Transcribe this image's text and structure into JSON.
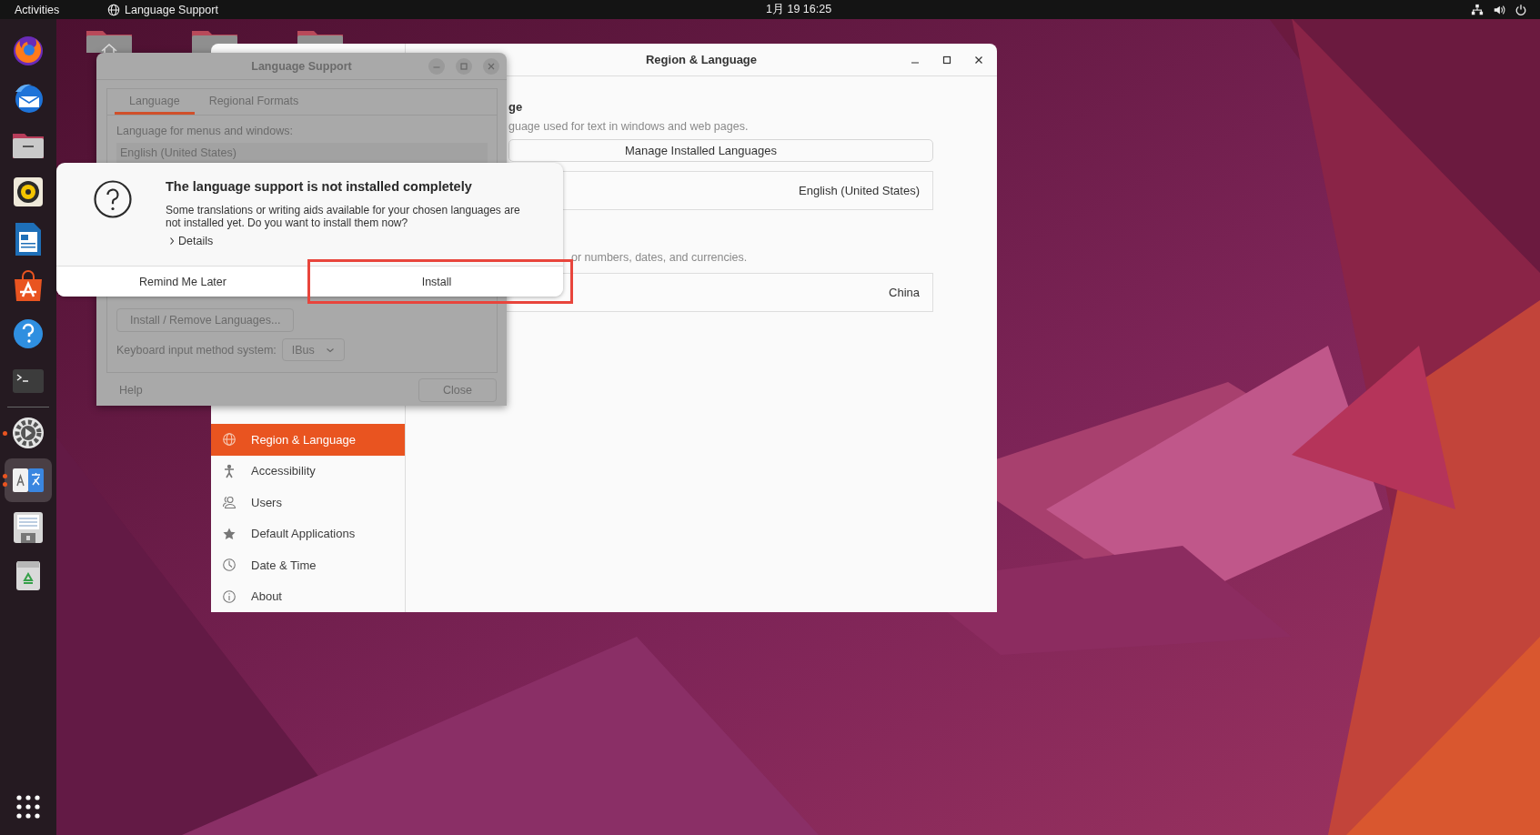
{
  "top_bar": {
    "activities": "Activities",
    "app_name": "Language Support",
    "clock": "1月 19  16:25"
  },
  "dock": [
    {
      "kind": "browser",
      "running": false,
      "multiple_windows": false,
      "focused": false
    },
    {
      "kind": "mail",
      "running": false,
      "multiple_windows": false,
      "focused": false
    },
    {
      "kind": "files",
      "running": false,
      "multiple_windows": false,
      "focused": false
    },
    {
      "kind": "music",
      "running": false,
      "multiple_windows": false,
      "focused": false
    },
    {
      "kind": "writer",
      "running": false,
      "multiple_windows": false,
      "focused": false
    },
    {
      "kind": "store",
      "running": false,
      "multiple_windows": false,
      "focused": false
    },
    {
      "kind": "help",
      "running": false,
      "multiple_windows": false,
      "focused": false
    },
    {
      "kind": "terminal",
      "running": false,
      "multiple_windows": false,
      "focused": false
    },
    {
      "kind": "settings",
      "running": true,
      "multiple_windows": false,
      "focused": false
    },
    {
      "kind": "language",
      "running": true,
      "multiple_windows": true,
      "focused": true
    },
    {
      "kind": "save",
      "running": false,
      "multiple_windows": false,
      "focused": false
    },
    {
      "kind": "trash",
      "running": false,
      "multiple_windows": false,
      "focused": false
    }
  ],
  "settings_window": {
    "title": "Region & Language",
    "sidebar": [
      {
        "kind": "globe",
        "label": "Region & Language",
        "selected": true
      },
      {
        "kind": "person",
        "label": "Accessibility",
        "selected": false
      },
      {
        "kind": "users",
        "label": "Users",
        "selected": false
      },
      {
        "kind": "star",
        "label": "Default Applications",
        "selected": false
      },
      {
        "kind": "clock",
        "label": "Date & Time",
        "selected": false
      },
      {
        "kind": "info",
        "label": "About",
        "selected": false
      }
    ],
    "language_heading": "ge",
    "language_description": "guage used for text in windows and web pages.",
    "manage_button": "Manage Installed Languages",
    "language_value": "English (United States)",
    "formats_description": "or numbers, dates, and currencies.",
    "formats_value": "China"
  },
  "language_support": {
    "title": "Language Support",
    "dimmed": true,
    "tabs": [
      {
        "label": "Language",
        "selected": true
      },
      {
        "label": "Regional Formats",
        "selected": false
      }
    ],
    "menu_label": "Language for menus and windows:",
    "languages": [
      "English (United States)"
    ],
    "install_remove_button": "Install / Remove Languages...",
    "input_method_label": "Keyboard input method system:",
    "input_method_value": "IBus",
    "help_button": "Help",
    "close_button": "Close"
  },
  "dialog": {
    "title": "The language support is not installed completely",
    "message": "Some translations or writing aids available for your chosen languages are not installed yet. Do you want to install them now?",
    "details": "Details",
    "buttons": [
      {
        "label": "Remind Me Later",
        "highlighted": false
      },
      {
        "label": "Install",
        "highlighted": true
      }
    ]
  }
}
